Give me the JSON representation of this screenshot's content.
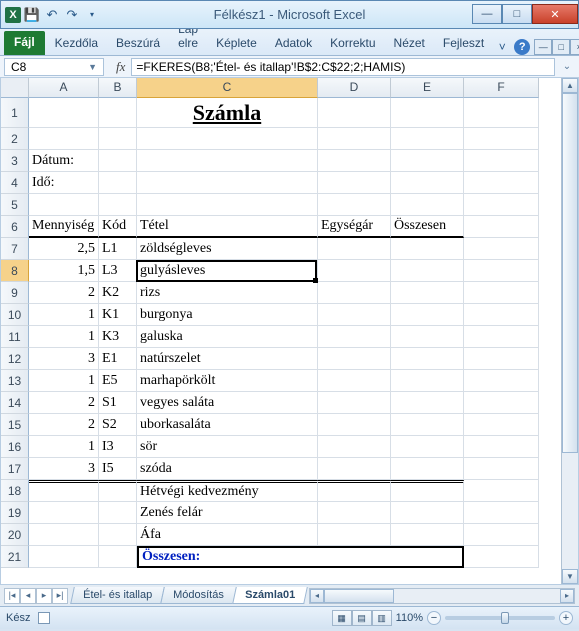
{
  "window": {
    "title": "Félkész1 - Microsoft Excel"
  },
  "qat_icons": [
    "excel",
    "save",
    "undo",
    "redo"
  ],
  "ribbon": {
    "file": "Fájl",
    "tabs": [
      "Kezdőla",
      "Beszúrá",
      "Lap elre",
      "Képlete",
      "Adatok",
      "Korrektu",
      "Nézet",
      "Fejleszt"
    ]
  },
  "namebox": "C8",
  "formula": "=FKERES(B8;'Étel- és itallap'!B$2:C$22;2;HAMIS)",
  "columns": [
    "A",
    "B",
    "C",
    "D",
    "E",
    "F"
  ],
  "rows": [
    "1",
    "2",
    "3",
    "4",
    "5",
    "6",
    "7",
    "8",
    "9",
    "10",
    "11",
    "12",
    "13",
    "14",
    "15",
    "16",
    "17",
    "18",
    "19",
    "20",
    "21"
  ],
  "sheet": {
    "title": "Számla",
    "datum_label": "Dátum:",
    "ido_label": "Idő:",
    "headers": {
      "menny": "Mennyiség",
      "kod": "Kód",
      "tetel": "Tétel",
      "egysegar": "Egységár",
      "osszesen": "Összesen"
    },
    "items": [
      {
        "qty": "2,5",
        "code": "L1",
        "name": "zöldségleves"
      },
      {
        "qty": "1,5",
        "code": "L3",
        "name": "gulyásleves"
      },
      {
        "qty": "2",
        "code": "K2",
        "name": "rizs"
      },
      {
        "qty": "1",
        "code": "K1",
        "name": "burgonya"
      },
      {
        "qty": "1",
        "code": "K3",
        "name": "galuska"
      },
      {
        "qty": "3",
        "code": "E1",
        "name": "natúrszelet"
      },
      {
        "qty": "1",
        "code": "E5",
        "name": "marhapörkölt"
      },
      {
        "qty": "2",
        "code": "S1",
        "name": "vegyes saláta"
      },
      {
        "qty": "2",
        "code": "S2",
        "name": "uborkasaláta"
      },
      {
        "qty": "1",
        "code": "I3",
        "name": "sör"
      },
      {
        "qty": "3",
        "code": "I5",
        "name": "szóda"
      }
    ],
    "footer": {
      "hetvegi": "Hétvégi kedvezmény",
      "zenes": "Zenés felár",
      "afa": "Áfa",
      "osszesen": "Összesen:"
    }
  },
  "tabs": [
    {
      "name": "Étel- és itallap",
      "active": false
    },
    {
      "name": "Módosítás",
      "active": false
    },
    {
      "name": "Számla01",
      "active": true
    }
  ],
  "status": {
    "ready": "Kész",
    "zoom": "110%"
  }
}
